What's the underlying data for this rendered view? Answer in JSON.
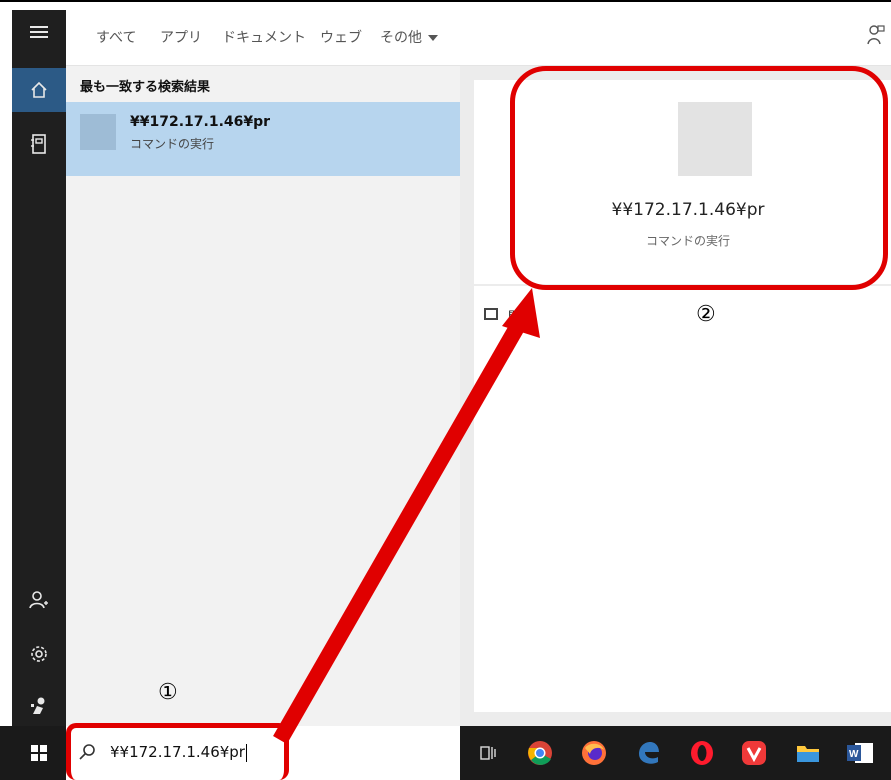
{
  "tabs": [
    {
      "label": "すべて"
    },
    {
      "label": "アプリ"
    },
    {
      "label": "ドキュメント"
    },
    {
      "label": "ウェブ"
    },
    {
      "label": "その他"
    }
  ],
  "results": {
    "section_title": "最も一致する検索結果",
    "best_match": {
      "title": "¥¥172.17.1.46¥pr",
      "subtitle": "コマンドの実行"
    }
  },
  "preview": {
    "title": "¥¥172.17.1.46¥pr",
    "subtitle": "コマンドの実行",
    "open_label": "開く"
  },
  "search": {
    "value": "¥¥172.17.1.46¥pr"
  },
  "annotations": {
    "marker_1": "①",
    "marker_2": "②"
  },
  "colors": {
    "accent": "#e00000",
    "selection": "#b7d5ee",
    "rail": "#1f1f1f",
    "taskbar": "#1a1a1a"
  },
  "icons": {
    "rail": [
      "hamburger-icon",
      "home-icon",
      "notebook-icon",
      "account-add-icon",
      "settings-gear-icon",
      "feedback-icon"
    ],
    "taskbar": [
      "windows-start-icon",
      "search-icon",
      "task-view-icon",
      "chrome-icon",
      "firefox-icon",
      "edge-icon",
      "opera-icon",
      "vivaldi-icon",
      "file-explorer-icon",
      "word-icon"
    ]
  }
}
